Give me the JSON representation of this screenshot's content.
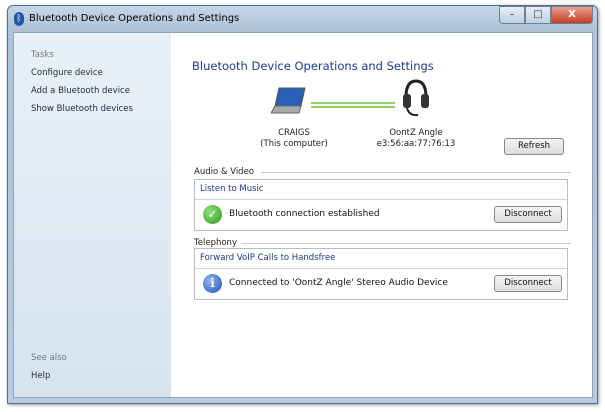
{
  "window": {
    "title": "Bluetooth Device Operations and Settings",
    "controls": {
      "minimize": "–",
      "maximize": "□",
      "close": "X"
    }
  },
  "sidebar": {
    "tasks_header": "Tasks",
    "items": [
      "Configure device",
      "Add a Bluetooth device",
      "Show Bluetooth devices"
    ],
    "see_also_header": "See also",
    "see_also_items": [
      "Help"
    ]
  },
  "main": {
    "heading": "Bluetooth Device Operations and Settings",
    "computer": {
      "name": "CRAIGS",
      "subtitle": "(This computer)"
    },
    "device": {
      "name": "OontZ Angle",
      "address": "e3:56:aa:77:76:13"
    },
    "refresh_label": "Refresh",
    "sections": [
      {
        "title": "Audio & Video",
        "service": "Listen to Music",
        "status": "Bluetooth connection established",
        "status_icon": "check-icon",
        "button": "Disconnect"
      },
      {
        "title": "Telephony",
        "service": "Forward VoIP Calls to Handsfree",
        "status": "Connected to 'OontZ Angle' Stereo Audio Device",
        "status_icon": "info-icon",
        "button": "Disconnect"
      }
    ]
  },
  "colors": {
    "accent": "#1e3a8a",
    "link_line": "#8fcf6a"
  }
}
